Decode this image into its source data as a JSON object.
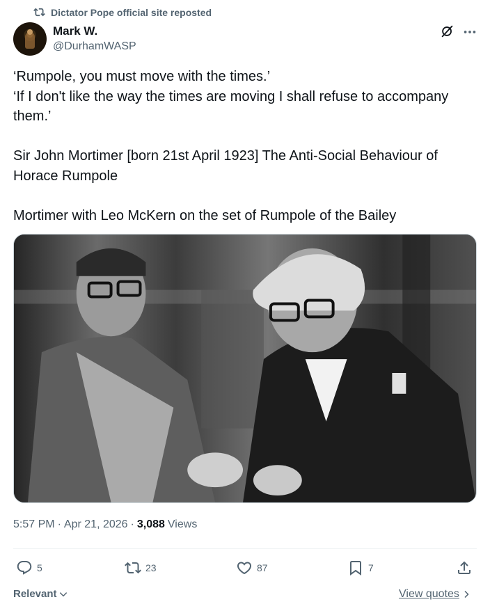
{
  "repost": {
    "label": "Dictator Pope official site reposted",
    "icon": "retweet-icon"
  },
  "author": {
    "name": "Mark W.",
    "handle": "@DurhamWASP"
  },
  "tweet": {
    "lines": [
      "‘Rumpole, you must move with the times.’",
      "‘If I don't like the way the times are moving I shall refuse to accompany them.’",
      "",
      "Sir John Mortimer [born 21st April 1923] The Anti-Social Behaviour of Horace Rumpole",
      "",
      "Mortimer with Leo McKern on the set of Rumpole of the Bailey"
    ]
  },
  "meta": {
    "time": "5:57 PM",
    "sep1": "·",
    "date": "Apr 21, 2026",
    "sep2": "·",
    "views_count": "3,088",
    "views_label": "Views"
  },
  "actions": {
    "replies": "5",
    "reposts": "23",
    "likes": "87",
    "bookmarks": "7"
  },
  "footer": {
    "relevant": "Relevant",
    "view_quotes": "View quotes"
  },
  "colors": {
    "text": "#0f1419",
    "secondary": "#536471",
    "border": "#eff3f4"
  }
}
